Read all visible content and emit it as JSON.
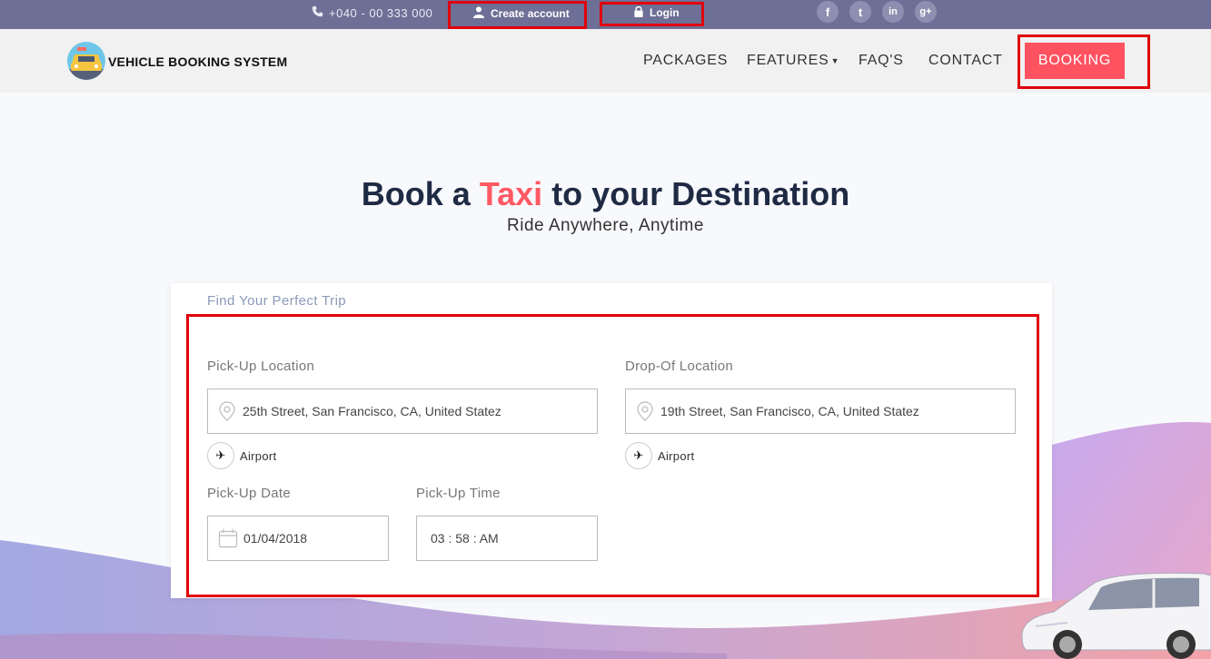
{
  "topbar": {
    "phone": "+040 - 00 333 000",
    "create_account": "Create account",
    "login": "Login",
    "social": [
      "f",
      "t",
      "in",
      "g+"
    ]
  },
  "header": {
    "logo_text": "VEHICLE BOOKING SYSTEM",
    "nav": [
      "PACKAGES",
      "FEATURES",
      "FAQ'S",
      "CONTACT"
    ],
    "booking": "BOOKING"
  },
  "hero": {
    "title_pre": "Book a ",
    "title_accent": "Taxi",
    "title_post": " to your Destination",
    "subtitle": "Ride Anywhere, Anytime"
  },
  "form": {
    "title": "Find Your Perfect Trip",
    "pickup_label": "Pick-Up Location",
    "pickup_value": "25th Street, San Francisco, CA, United Statez",
    "dropoff_label": "Drop-Of Location",
    "dropoff_value": "19th Street, San Francisco, CA, United Statez",
    "airport_label": "Airport",
    "date_label": "Pick-Up Date",
    "date_value": "01/04/2018",
    "time_label": "Pick-Up Time",
    "time_value": "03 : 58 : AM"
  },
  "colors": {
    "topbar": "#6e6f96",
    "accent": "#ff5260",
    "highlight_box": "#e0000b"
  }
}
